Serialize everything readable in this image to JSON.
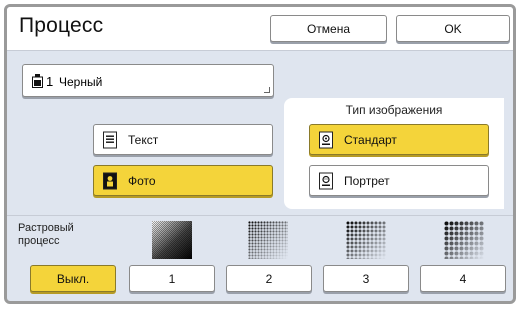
{
  "header": {
    "title": "Процесс",
    "cancel_label": "Отмена",
    "ok_label": "OK"
  },
  "color": {
    "number": "1",
    "name": "Черный"
  },
  "image_type": {
    "title": "Тип изображения"
  },
  "original_type": {
    "text_label": "Текст",
    "photo_label": "Фото",
    "standard_label": "Стандарт",
    "portrait_label": "Портрет",
    "selected": "Фото",
    "selected_image_type": "Стандарт"
  },
  "raster": {
    "label_line1": "Растровый",
    "label_line2": "процесс",
    "buttons": [
      "Выкл.",
      "1",
      "2",
      "3",
      "4"
    ],
    "selected": "Выкл."
  },
  "colors": {
    "selected": "#f4d43a",
    "panel_bg": "#dfe5ef"
  }
}
